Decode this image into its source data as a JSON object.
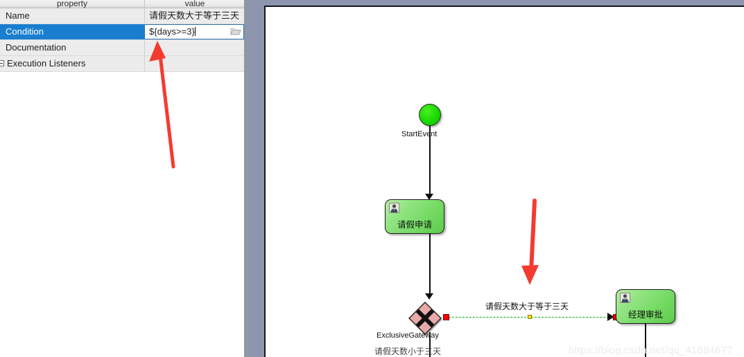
{
  "property_panel": {
    "columns": [
      "property",
      "value"
    ],
    "rows": [
      {
        "property": "Name",
        "value": "请假天数大于等于三天",
        "selected": false,
        "editing": false,
        "has_expander": false,
        "has_folder_button": false
      },
      {
        "property": "Condition",
        "value": "${days>=3}",
        "selected": true,
        "editing": true,
        "has_expander": false,
        "has_folder_button": true
      },
      {
        "property": "Documentation",
        "value": "",
        "selected": false,
        "editing": false,
        "has_expander": false,
        "has_folder_button": false
      },
      {
        "property": "Execution Listeners",
        "value": "",
        "selected": false,
        "editing": false,
        "has_expander": true,
        "has_folder_button": false
      }
    ],
    "folder_icon": "folder-icon",
    "expander_icon": "collapse-box-icon"
  },
  "canvas": {
    "watermark": "https://blog.csdn.net/qq_41884677",
    "nodes": [
      {
        "id": "start-event",
        "type": "start-event",
        "label": "StartEvent",
        "color": "#18d900"
      },
      {
        "id": "task-apply",
        "type": "user-task",
        "label": "请假申请",
        "color": "#6fd75e",
        "icon": "user-icon"
      },
      {
        "id": "exclusive-gateway",
        "type": "exclusive-gateway",
        "label": "ExclusiveGateway",
        "color": "#e9a9a9",
        "selected": true
      },
      {
        "id": "task-approve",
        "type": "user-task",
        "label": "经理审批",
        "color": "#6fd75e",
        "icon": "user-icon"
      }
    ],
    "flows": [
      {
        "id": "flow-selected",
        "label": "请假天数大于等于三天",
        "selected": true,
        "color": "#00b400",
        "style": "dashed"
      },
      {
        "id": "flow-other",
        "label": "请假天数小于三天",
        "selected": false,
        "color": "#0d0d0d",
        "style": "solid"
      }
    ]
  },
  "annotations": {
    "arrow_color": "#f43b30",
    "arrows": [
      {
        "name": "arrow-to-condition-value",
        "direction": "up-left"
      },
      {
        "name": "arrow-to-sequence-flow",
        "direction": "down"
      }
    ]
  }
}
